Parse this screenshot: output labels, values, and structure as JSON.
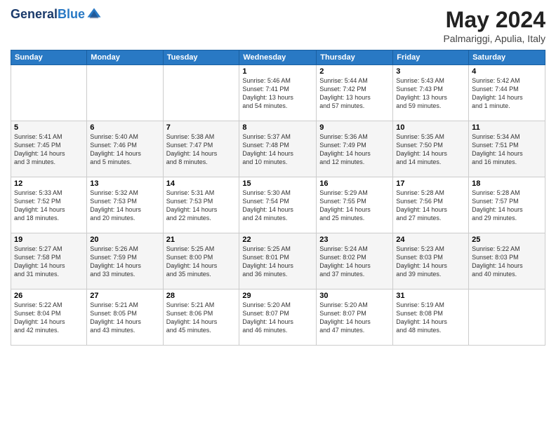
{
  "header": {
    "logo_line1": "General",
    "logo_line2": "Blue",
    "month_year": "May 2024",
    "location": "Palmariggi, Apulia, Italy"
  },
  "weekdays": [
    "Sunday",
    "Monday",
    "Tuesday",
    "Wednesday",
    "Thursday",
    "Friday",
    "Saturday"
  ],
  "weeks": [
    [
      {
        "day": "",
        "info": ""
      },
      {
        "day": "",
        "info": ""
      },
      {
        "day": "",
        "info": ""
      },
      {
        "day": "1",
        "info": "Sunrise: 5:46 AM\nSunset: 7:41 PM\nDaylight: 13 hours\nand 54 minutes."
      },
      {
        "day": "2",
        "info": "Sunrise: 5:44 AM\nSunset: 7:42 PM\nDaylight: 13 hours\nand 57 minutes."
      },
      {
        "day": "3",
        "info": "Sunrise: 5:43 AM\nSunset: 7:43 PM\nDaylight: 13 hours\nand 59 minutes."
      },
      {
        "day": "4",
        "info": "Sunrise: 5:42 AM\nSunset: 7:44 PM\nDaylight: 14 hours\nand 1 minute."
      }
    ],
    [
      {
        "day": "5",
        "info": "Sunrise: 5:41 AM\nSunset: 7:45 PM\nDaylight: 14 hours\nand 3 minutes."
      },
      {
        "day": "6",
        "info": "Sunrise: 5:40 AM\nSunset: 7:46 PM\nDaylight: 14 hours\nand 5 minutes."
      },
      {
        "day": "7",
        "info": "Sunrise: 5:38 AM\nSunset: 7:47 PM\nDaylight: 14 hours\nand 8 minutes."
      },
      {
        "day": "8",
        "info": "Sunrise: 5:37 AM\nSunset: 7:48 PM\nDaylight: 14 hours\nand 10 minutes."
      },
      {
        "day": "9",
        "info": "Sunrise: 5:36 AM\nSunset: 7:49 PM\nDaylight: 14 hours\nand 12 minutes."
      },
      {
        "day": "10",
        "info": "Sunrise: 5:35 AM\nSunset: 7:50 PM\nDaylight: 14 hours\nand 14 minutes."
      },
      {
        "day": "11",
        "info": "Sunrise: 5:34 AM\nSunset: 7:51 PM\nDaylight: 14 hours\nand 16 minutes."
      }
    ],
    [
      {
        "day": "12",
        "info": "Sunrise: 5:33 AM\nSunset: 7:52 PM\nDaylight: 14 hours\nand 18 minutes."
      },
      {
        "day": "13",
        "info": "Sunrise: 5:32 AM\nSunset: 7:53 PM\nDaylight: 14 hours\nand 20 minutes."
      },
      {
        "day": "14",
        "info": "Sunrise: 5:31 AM\nSunset: 7:53 PM\nDaylight: 14 hours\nand 22 minutes."
      },
      {
        "day": "15",
        "info": "Sunrise: 5:30 AM\nSunset: 7:54 PM\nDaylight: 14 hours\nand 24 minutes."
      },
      {
        "day": "16",
        "info": "Sunrise: 5:29 AM\nSunset: 7:55 PM\nDaylight: 14 hours\nand 25 minutes."
      },
      {
        "day": "17",
        "info": "Sunrise: 5:28 AM\nSunset: 7:56 PM\nDaylight: 14 hours\nand 27 minutes."
      },
      {
        "day": "18",
        "info": "Sunrise: 5:28 AM\nSunset: 7:57 PM\nDaylight: 14 hours\nand 29 minutes."
      }
    ],
    [
      {
        "day": "19",
        "info": "Sunrise: 5:27 AM\nSunset: 7:58 PM\nDaylight: 14 hours\nand 31 minutes."
      },
      {
        "day": "20",
        "info": "Sunrise: 5:26 AM\nSunset: 7:59 PM\nDaylight: 14 hours\nand 33 minutes."
      },
      {
        "day": "21",
        "info": "Sunrise: 5:25 AM\nSunset: 8:00 PM\nDaylight: 14 hours\nand 35 minutes."
      },
      {
        "day": "22",
        "info": "Sunrise: 5:25 AM\nSunset: 8:01 PM\nDaylight: 14 hours\nand 36 minutes."
      },
      {
        "day": "23",
        "info": "Sunrise: 5:24 AM\nSunset: 8:02 PM\nDaylight: 14 hours\nand 37 minutes."
      },
      {
        "day": "24",
        "info": "Sunrise: 5:23 AM\nSunset: 8:03 PM\nDaylight: 14 hours\nand 39 minutes."
      },
      {
        "day": "25",
        "info": "Sunrise: 5:22 AM\nSunset: 8:03 PM\nDaylight: 14 hours\nand 40 minutes."
      }
    ],
    [
      {
        "day": "26",
        "info": "Sunrise: 5:22 AM\nSunset: 8:04 PM\nDaylight: 14 hours\nand 42 minutes."
      },
      {
        "day": "27",
        "info": "Sunrise: 5:21 AM\nSunset: 8:05 PM\nDaylight: 14 hours\nand 43 minutes."
      },
      {
        "day": "28",
        "info": "Sunrise: 5:21 AM\nSunset: 8:06 PM\nDaylight: 14 hours\nand 45 minutes."
      },
      {
        "day": "29",
        "info": "Sunrise: 5:20 AM\nSunset: 8:07 PM\nDaylight: 14 hours\nand 46 minutes."
      },
      {
        "day": "30",
        "info": "Sunrise: 5:20 AM\nSunset: 8:07 PM\nDaylight: 14 hours\nand 47 minutes."
      },
      {
        "day": "31",
        "info": "Sunrise: 5:19 AM\nSunset: 8:08 PM\nDaylight: 14 hours\nand 48 minutes."
      },
      {
        "day": "",
        "info": ""
      }
    ]
  ]
}
